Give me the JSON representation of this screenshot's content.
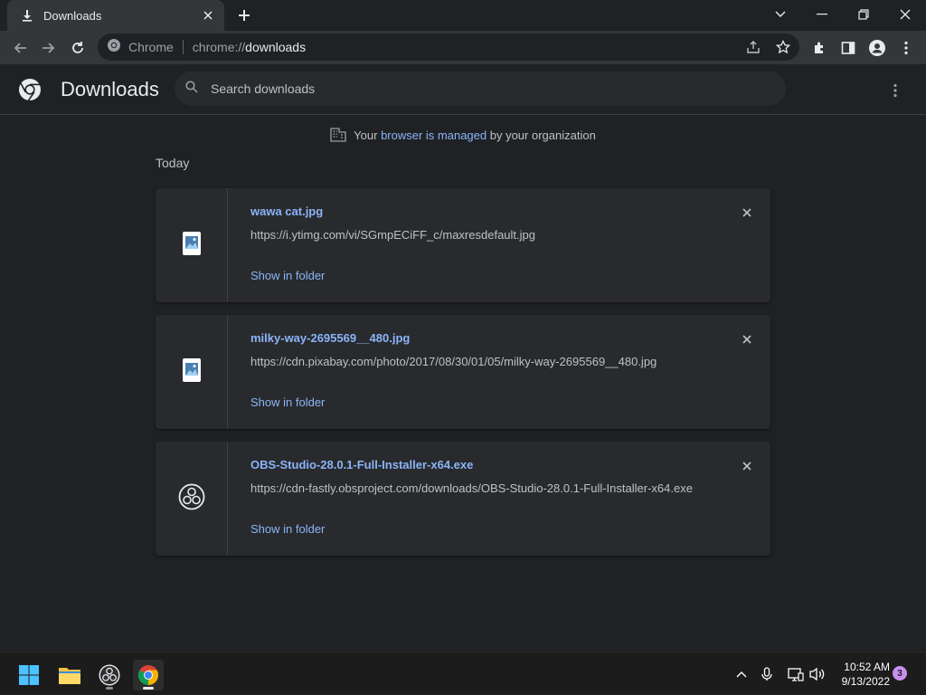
{
  "tab": {
    "title": "Downloads"
  },
  "omnibox": {
    "site_label": "Chrome",
    "url_scheme": "chrome://",
    "url_host": "downloads"
  },
  "header": {
    "title": "Downloads",
    "search_placeholder": "Search downloads"
  },
  "managed": {
    "prefix": "Your ",
    "link": "browser is managed",
    "suffix": " by your organization"
  },
  "section": {
    "title": "Today"
  },
  "downloads": [
    {
      "name": "wawa cat.jpg",
      "url": "https://i.ytimg.com/vi/SGmpECiFF_c/maxresdefault.jpg",
      "action": "Show in folder",
      "icon": "image-file-icon"
    },
    {
      "name": "milky-way-2695569__480.jpg",
      "url": "https://cdn.pixabay.com/photo/2017/08/30/01/05/milky-way-2695569__480.jpg",
      "action": "Show in folder",
      "icon": "image-file-icon"
    },
    {
      "name": "OBS-Studio-28.0.1-Full-Installer-x64.exe",
      "url": "https://cdn-fastly.obsproject.com/downloads/OBS-Studio-28.0.1-Full-Installer-x64.exe",
      "action": "Show in folder",
      "icon": "obs-icon"
    }
  ],
  "taskbar": {
    "time": "10:52 AM",
    "date": "9/13/2022",
    "notifications": "3"
  },
  "colors": {
    "background": "#202124",
    "toolbar": "#35363a",
    "card": "#292a2d",
    "link": "#8ab4f8"
  }
}
